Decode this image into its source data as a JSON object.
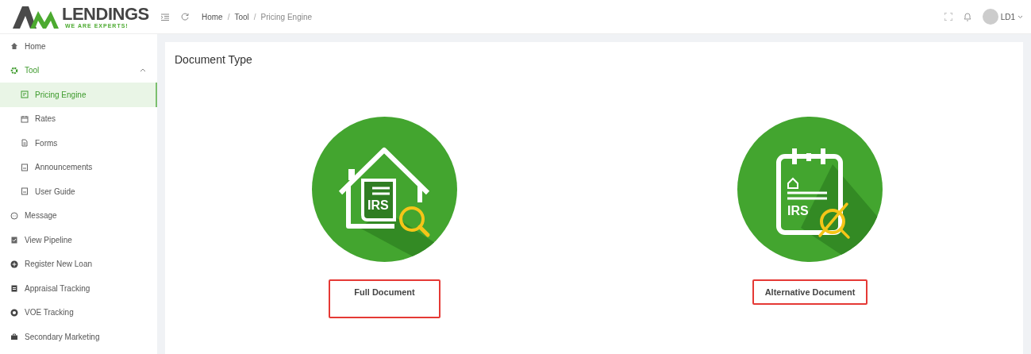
{
  "logo": {
    "name": "LENDINGS",
    "tagline": "WE ARE EXPERTS!"
  },
  "breadcrumb": [
    "Home",
    "Tool",
    "Pricing Engine"
  ],
  "breadcrumb_separator": "/",
  "user": {
    "name": "LD1"
  },
  "sidebar": {
    "items": [
      {
        "label": "Home",
        "selected": false
      },
      {
        "label": "Tool",
        "selected": true,
        "expanded": true,
        "children": [
          {
            "label": "Pricing Engine",
            "selected": true
          },
          {
            "label": "Rates",
            "selected": false
          },
          {
            "label": "Forms",
            "selected": false
          },
          {
            "label": "Announcements",
            "selected": false
          },
          {
            "label": "User Guide",
            "selected": false
          }
        ]
      },
      {
        "label": "Message",
        "selected": false
      },
      {
        "label": "View Pipeline",
        "selected": false
      },
      {
        "label": "Register New Loan",
        "selected": false
      },
      {
        "label": "Appraisal Tracking",
        "selected": false
      },
      {
        "label": "VOE Tracking",
        "selected": false
      },
      {
        "label": "Secondary Marketing",
        "selected": false
      }
    ]
  },
  "page": {
    "title": "Document Type",
    "options": [
      {
        "kind": "house",
        "badge": "IRS",
        "label": "Full Document",
        "highlighted": true,
        "tall": true
      },
      {
        "kind": "notepad",
        "badge": "IRS",
        "label": "Alternative Document",
        "highlighted": true,
        "tall": false
      }
    ]
  }
}
